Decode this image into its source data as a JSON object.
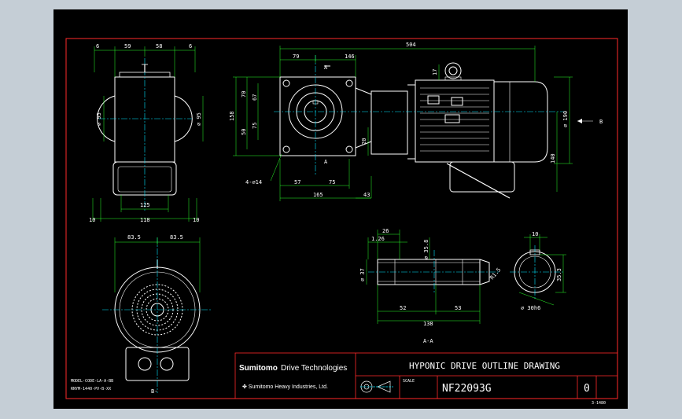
{
  "colors": {
    "border": "#ff2a2a",
    "dimension": "#2bff2b",
    "center": "#00e5ff",
    "outline": "#ffffff",
    "background": "#000000",
    "frame": "#c5ced6"
  },
  "top_view": {
    "d6a": "6",
    "d59": "59",
    "d58": "58",
    "d6b": "6",
    "dia95a": "⌀ 95",
    "dia95b": "⌀ 95",
    "d125": "125",
    "d10a": "10",
    "d118": "118",
    "d10b": "10"
  },
  "side_view": {
    "d504": "504",
    "d79": "79",
    "d146": "146",
    "labelA1": "A",
    "labelA2": "A",
    "d70": "70",
    "d67": "67",
    "d75v": "75",
    "d50": "50",
    "d158": "158",
    "d20": "20",
    "d17": "17",
    "d190": "⌀ 190",
    "d140": "140",
    "holes": "4-⌀14",
    "d57": "57",
    "d75": "75",
    "d165": "165",
    "d43": "43",
    "arrowB": "B"
  },
  "bottom_view": {
    "d835a": "83.5",
    "d835b": "83.5",
    "labelB": "B-"
  },
  "shaft_view": {
    "d26": "26",
    "d126": "1.26",
    "d358": "⌀ 35.8",
    "d37": "⌀ 37",
    "d52": "52",
    "d53": "53",
    "d138": "138",
    "d15": "R1.5",
    "labelAA": "A-A"
  },
  "key_view": {
    "d10": "10",
    "d353": "35.3",
    "d30": "⌀ 30h6"
  },
  "notes": {
    "note1": "MODEL-CODE-LA-A-BB",
    "note2": "RNYM-1440-PV-B-XX"
  },
  "title_block": {
    "brand_main": "Sumitomo",
    "brand_sub": "Drive Technologies",
    "company": "✤ Sumitomo Heavy Industries, Ltd.",
    "title": "HYPONIC DRIVE OUTLINE DRAWING",
    "scale_label": "SCALE",
    "drawing_no": "NF22093G",
    "revision": "0",
    "sheet_code": "3-1480"
  }
}
